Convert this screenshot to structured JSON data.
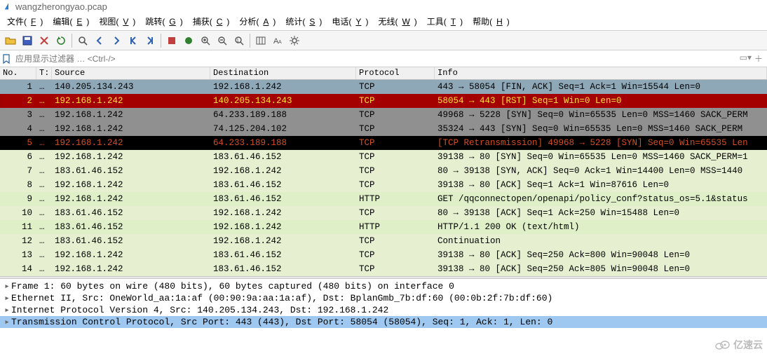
{
  "title": "wangzherongyao.pcap",
  "menu": [
    "文件(F)",
    "编辑(E)",
    "视图(V)",
    "跳转(G)",
    "捕获(C)",
    "分析(A)",
    "统计(S)",
    "电话(Y)",
    "无线(W)",
    "工具(T)",
    "帮助(H)"
  ],
  "filter_placeholder": "应用显示过滤器 … <Ctrl-/>",
  "columns": {
    "no": "No.",
    "t": "T:",
    "source": "Source",
    "dest": "Destination",
    "proto": "Protocol",
    "info": "Info"
  },
  "rows": [
    {
      "no": "1",
      "t": "…",
      "src": "140.205.134.243",
      "dst": "192.168.1.242",
      "proto": "TCP",
      "info": "443 → 58054 [FIN, ACK] Seq=1 Ack=1 Win=15544 Len=0",
      "bg": "#8fa8b8",
      "fg": "#000"
    },
    {
      "no": "2",
      "t": "…",
      "src": "192.168.1.242",
      "dst": "140.205.134.243",
      "proto": "TCP",
      "info": "58054 → 443 [RST] Seq=1 Win=0 Len=0",
      "bg": "#a40000",
      "fg": "#ffe040",
      "edge": true
    },
    {
      "no": "3",
      "t": "…",
      "src": "192.168.1.242",
      "dst": "64.233.189.188",
      "proto": "TCP",
      "info": "49968 → 5228 [SYN] Seq=0 Win=65535 Len=0 MSS=1460 SACK_PERM",
      "bg": "#909090",
      "fg": "#000"
    },
    {
      "no": "4",
      "t": "…",
      "src": "192.168.1.242",
      "dst": "74.125.204.102",
      "proto": "TCP",
      "info": "35324 → 443 [SYN] Seq=0 Win=65535 Len=0 MSS=1460 SACK_PERM",
      "bg": "#909090",
      "fg": "#000"
    },
    {
      "no": "5",
      "t": "…",
      "src": "192.168.1.242",
      "dst": "64.233.189.188",
      "proto": "TCP",
      "info": "[TCP Retransmission] 49968 → 5228 [SYN] Seq=0 Win=65535 Len",
      "bg": "#000000",
      "fg": "#d05028"
    },
    {
      "no": "6",
      "t": "…",
      "src": "192.168.1.242",
      "dst": "183.61.46.152",
      "proto": "TCP",
      "info": "39138 → 80 [SYN] Seq=0 Win=65535 Len=0 MSS=1460 SACK_PERM=1",
      "bg": "#e6f0d0",
      "fg": "#000"
    },
    {
      "no": "7",
      "t": "…",
      "src": "183.61.46.152",
      "dst": "192.168.1.242",
      "proto": "TCP",
      "info": "80 → 39138 [SYN, ACK] Seq=0 Ack=1 Win=14400 Len=0 MSS=1440",
      "bg": "#e6f0d0",
      "fg": "#000"
    },
    {
      "no": "8",
      "t": "…",
      "src": "192.168.1.242",
      "dst": "183.61.46.152",
      "proto": "TCP",
      "info": "39138 → 80 [ACK] Seq=1 Ack=1 Win=87616 Len=0",
      "bg": "#e6f0d0",
      "fg": "#000"
    },
    {
      "no": "9",
      "t": "…",
      "src": "192.168.1.242",
      "dst": "183.61.46.152",
      "proto": "HTTP",
      "info": "GET /qqconnectopen/openapi/policy_conf?status_os=5.1&status",
      "bg": "#dff0c8",
      "fg": "#000"
    },
    {
      "no": "10",
      "t": "…",
      "src": "183.61.46.152",
      "dst": "192.168.1.242",
      "proto": "TCP",
      "info": "80 → 39138 [ACK] Seq=1 Ack=250 Win=15488 Len=0",
      "bg": "#e6f0d0",
      "fg": "#000"
    },
    {
      "no": "11",
      "t": "…",
      "src": "183.61.46.152",
      "dst": "192.168.1.242",
      "proto": "HTTP",
      "info": "HTTP/1.1 200 OK  (text/html)",
      "bg": "#dff0c8",
      "fg": "#000"
    },
    {
      "no": "12",
      "t": "…",
      "src": "183.61.46.152",
      "dst": "192.168.1.242",
      "proto": "TCP",
      "info": "Continuation",
      "bg": "#e6f0d0",
      "fg": "#000"
    },
    {
      "no": "13",
      "t": "…",
      "src": "192.168.1.242",
      "dst": "183.61.46.152",
      "proto": "TCP",
      "info": "39138 → 80 [ACK] Seq=250 Ack=800 Win=90048 Len=0",
      "bg": "#e6f0d0",
      "fg": "#000"
    },
    {
      "no": "14",
      "t": "…",
      "src": "192.168.1.242",
      "dst": "183.61.46.152",
      "proto": "TCP",
      "info": "39138 → 80 [ACK] Seq=250 Ack=805 Win=90048 Len=0",
      "bg": "#e6f0d0",
      "fg": "#000"
    }
  ],
  "details": [
    {
      "text": "Frame 1: 60 bytes on wire (480 bits), 60 bytes captured (480 bits) on interface 0",
      "sel": false
    },
    {
      "text": "Ethernet II, Src: OneWorld_aa:1a:af (00:90:9a:aa:1a:af), Dst: BplanGmb_7b:df:60 (00:0b:2f:7b:df:60)",
      "sel": false
    },
    {
      "text": "Internet Protocol Version 4, Src: 140.205.134.243, Dst: 192.168.1.242",
      "sel": false
    },
    {
      "text": "Transmission Control Protocol, Src Port: 443 (443), Dst Port: 58054 (58054), Seq: 1, Ack: 1, Len: 0",
      "sel": true
    }
  ],
  "watermark": "亿速云",
  "toolbar_icons": [
    "folder-open",
    "save",
    "close",
    "reload",
    "search",
    "back",
    "forward",
    "skip-back",
    "skip-forward",
    "stop",
    "record",
    "zoom-in",
    "zoom-out",
    "zoom-fit",
    "columns",
    "text-size",
    "settings"
  ]
}
